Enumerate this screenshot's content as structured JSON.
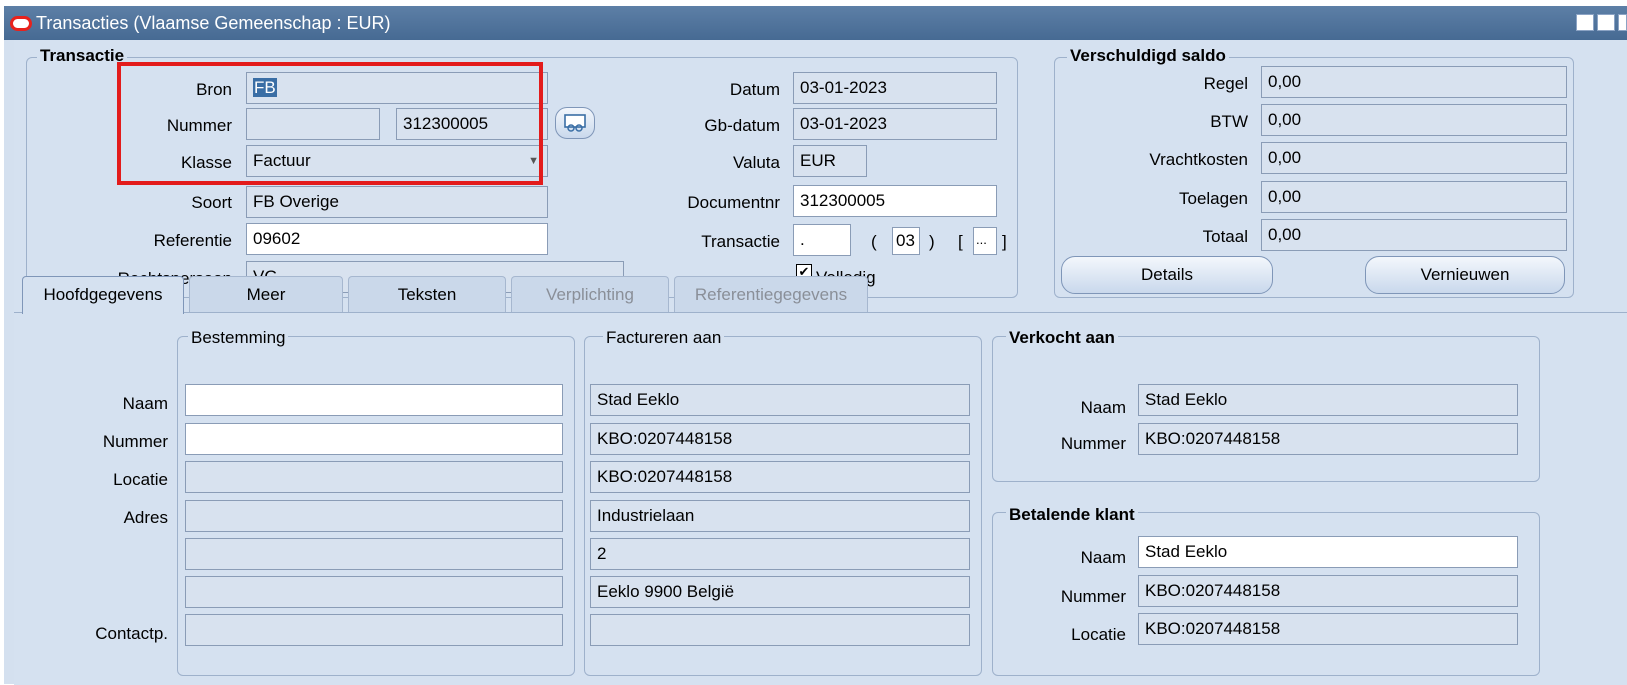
{
  "window": {
    "title": "Transacties (Vlaamse Gemeenschap : EUR)"
  },
  "transactie": {
    "title": "Transactie",
    "bron_label": "Bron",
    "bron_value": "FB",
    "nummer_label": "Nummer",
    "nummer_value": "312300005",
    "klasse_label": "Klasse",
    "klasse_value": "Factuur",
    "soort_label": "Soort",
    "soort_value": "FB Overige",
    "referentie_label": "Referentie",
    "referentie_value": "09602",
    "rechtspersoon_label": "Rechtspersoon",
    "rechtspersoon_value": "VG",
    "datum_label": "Datum",
    "datum_value": "03-01-2023",
    "gbdatum_label": "Gb-datum",
    "gbdatum_value": "03-01-2023",
    "valuta_label": "Valuta",
    "valuta_value": "EUR",
    "documentnr_label": "Documentnr",
    "documentnr_value": "312300005",
    "transactie_label": "Transactie",
    "transactie_value": ".",
    "transactie_paren_value": "03",
    "transactie_bracket_value": "...",
    "volledig_label": "Volledig",
    "volledig_checked": true
  },
  "saldo": {
    "title": "Verschuldigd saldo",
    "regel_label": "Regel",
    "regel_value": "0,00",
    "btw_label": "BTW",
    "btw_value": "0,00",
    "vrachtkosten_label": "Vrachtkosten",
    "vrachtkosten_value": "0,00",
    "toelagen_label": "Toelagen",
    "toelagen_value": "0,00",
    "totaal_label": "Totaal",
    "totaal_value": "0,00",
    "details_button": "Details",
    "vernieuwen_button": "Vernieuwen"
  },
  "tabs": [
    {
      "label": "Hoofdgegevens",
      "active": true
    },
    {
      "label": "Meer"
    },
    {
      "label": "Teksten"
    },
    {
      "label": "Verplichting",
      "disabled": true
    },
    {
      "label": "Referentiegegevens",
      "disabled": true
    }
  ],
  "bestemming": {
    "title": "Bestemming",
    "naam_label": "Naam",
    "nummer_label": "Nummer",
    "locatie_label": "Locatie",
    "adres_label": "Adres",
    "contactp_label": "Contactp."
  },
  "factureren": {
    "title": "Factureren aan",
    "lines": [
      "Stad Eeklo",
      "KBO:0207448158",
      "KBO:0207448158",
      "Industrielaan",
      "2",
      "Eeklo 9900 België",
      ""
    ]
  },
  "verkocht": {
    "title": "Verkocht aan",
    "naam_label": "Naam",
    "naam_value": "Stad Eeklo",
    "nummer_label": "Nummer",
    "nummer_value": "KBO:0207448158"
  },
  "betalende": {
    "title": "Betalende klant",
    "naam_label": "Naam",
    "naam_value": "Stad Eeklo",
    "nummer_label": "Nummer",
    "nummer_value": "KBO:0207448158",
    "locatie_label": "Locatie",
    "locatie_value": "KBO:0207448158"
  }
}
